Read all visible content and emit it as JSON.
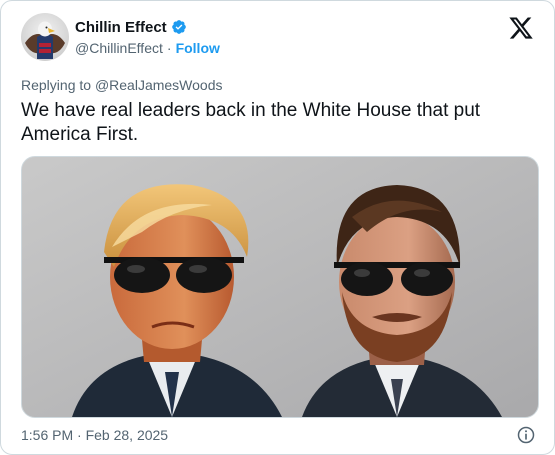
{
  "author": {
    "display_name": "Chillin Effect",
    "handle": "@ChillinEffect",
    "separator": "·",
    "follow_label": "Follow",
    "verified": true,
    "avatar_icon": "eagle-avatar-icon"
  },
  "reply": {
    "prefix": "Replying to ",
    "to_handle": "@RealJamesWoods"
  },
  "tweet": {
    "text": "We have real leaders back in the White House that put America First."
  },
  "media": {
    "image_icon": "two-men-sunglasses-illustration"
  },
  "footer": {
    "timestamp": "1:56 PM · Feb 28, 2025"
  },
  "colors": {
    "accent": "#1d9bf0",
    "text_primary": "#0f1419",
    "text_secondary": "#536471",
    "border": "#cfd9de"
  },
  "icons": {
    "brand": "x-logo-icon",
    "verified": "verified-badge-icon",
    "info": "info-icon"
  }
}
